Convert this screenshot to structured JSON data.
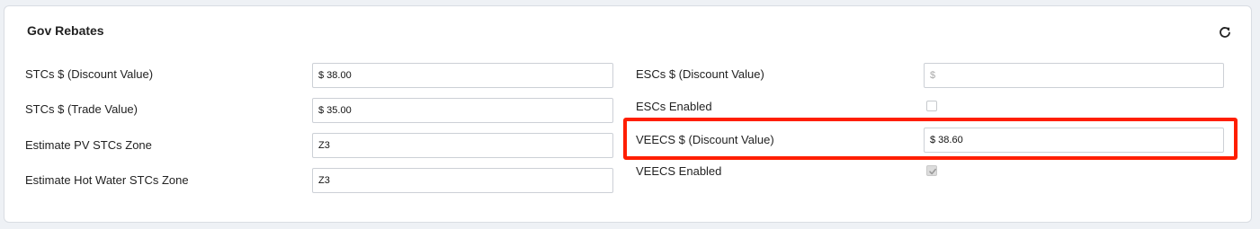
{
  "panel": {
    "title": "Gov Rebates",
    "refresh_icon": "refresh-icon"
  },
  "left_fields": [
    {
      "label": "STCs $ (Discount Value)",
      "value": "$ 38.00"
    },
    {
      "label": "STCs $ (Trade Value)",
      "value": "$ 35.00"
    },
    {
      "label": "Estimate PV STCs Zone",
      "value": "Z3"
    },
    {
      "label": "Estimate Hot Water STCs Zone",
      "value": "Z3"
    }
  ],
  "right_fields": {
    "escs_discount": {
      "label": "ESCs $ (Discount Value)",
      "value": "",
      "placeholder": "$"
    },
    "escs_enabled": {
      "label": "ESCs Enabled",
      "checked": false
    },
    "veecs_discount": {
      "label": "VEECS $ (Discount Value)",
      "value": "$ 38.60"
    },
    "veecs_enabled": {
      "label": "VEECS Enabled",
      "checked": true
    }
  },
  "highlight_color": "#ff1e00"
}
